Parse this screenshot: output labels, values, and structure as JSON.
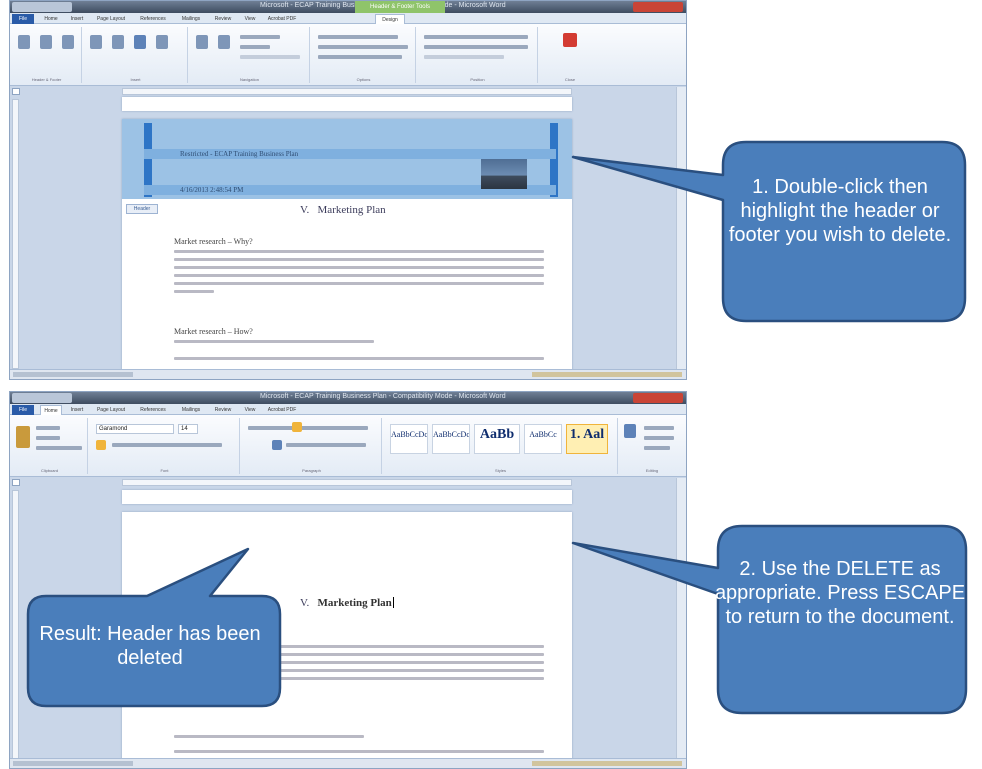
{
  "window": {
    "title_top": "Microsoft - ECAP Training Business Plan - Compatibility Mode - Microsoft Word",
    "title_bottom": "Microsoft - ECAP Training Business Plan - Compatibility Mode - Microsoft Word",
    "context_tab": "Header & Footer Tools"
  },
  "ribbon_top": {
    "tabs": [
      "File",
      "Home",
      "Insert",
      "Page Layout",
      "References",
      "Mailings",
      "Review",
      "View",
      "Acrobat PDF",
      "Design"
    ],
    "active_tab": "Design",
    "groups": [
      "Header & Footer",
      "Insert",
      "Navigation",
      "Options",
      "Position",
      "Close"
    ],
    "close_button": "Close Header and Footer"
  },
  "ribbon_bottom": {
    "tabs": [
      "File",
      "Home",
      "Insert",
      "Page Layout",
      "References",
      "Mailings",
      "Review",
      "View",
      "Acrobat PDF"
    ],
    "active_tab": "Home",
    "font_name": "Garamond",
    "font_size": "14",
    "groups": [
      "Clipboard",
      "Font",
      "Paragraph",
      "Styles",
      "Editing"
    ],
    "styles": [
      "AaBbCcDc",
      "AaBbCcDc",
      "AaBb",
      "AaBbCc",
      "1. Aal"
    ]
  },
  "document": {
    "header_line1": "Restricted - ECAP Training Business Plan",
    "header_line2": "4/16/2013 2:48:54 PM",
    "header_tag": "Header",
    "section_number": "V.",
    "section_title": "Marketing Plan",
    "sub1": "Market research – Why?",
    "sub2": "Market research – How?"
  },
  "callouts": {
    "step1": "1. Double-click then highlight the header or footer you wish to delete.",
    "step2": "2. Use the DELETE as appropriate. Press ESCAPE to return to the document.",
    "result": "Result: Header has been deleted"
  },
  "colors": {
    "callout_fill": "#4a7ebb",
    "callout_stroke": "#2a4f7f",
    "header_highlight": "#9cc2e5",
    "header_bar": "#2e75c6",
    "file_tab": "#2a5ba8"
  }
}
